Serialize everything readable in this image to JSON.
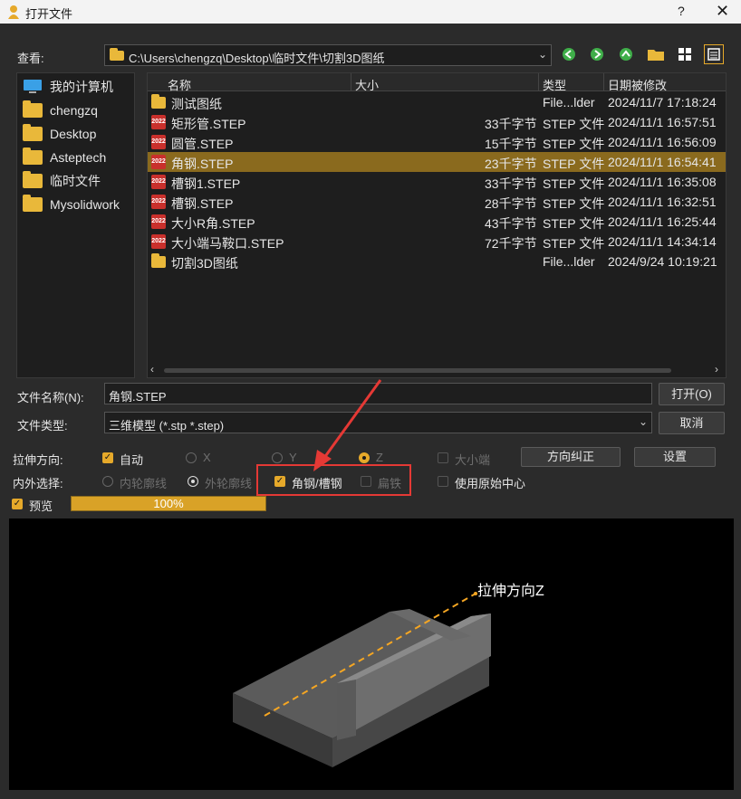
{
  "window": {
    "title": "打开文件",
    "help": "?",
    "close": "✕"
  },
  "lookin": {
    "label": "查看:",
    "path": "C:\\Users\\chengzq\\Desktop\\临时文件\\切割3D图纸"
  },
  "places": [
    {
      "label": "我的计算机",
      "icon": "computer-icon"
    },
    {
      "label": "chengzq",
      "icon": "folder-icon"
    },
    {
      "label": "Desktop",
      "icon": "folder-icon"
    },
    {
      "label": "Asteptech",
      "icon": "folder-icon"
    },
    {
      "label": "临时文件",
      "icon": "folder-icon"
    },
    {
      "label": "Mysolidwork",
      "icon": "folder-icon"
    }
  ],
  "columns": {
    "name": "名称",
    "size": "大小",
    "type": "类型",
    "date": "日期被修改"
  },
  "files": [
    {
      "name": "测试图纸",
      "size": "",
      "type": "File...lder",
      "date": "2024/11/7 17:18:24",
      "kind": "folder"
    },
    {
      "name": "矩形管.STEP",
      "size": "33千字节",
      "type": "STEP 文件",
      "date": "2024/11/1 16:57:51",
      "kind": "step"
    },
    {
      "name": "圆管.STEP",
      "size": "15千字节",
      "type": "STEP 文件",
      "date": "2024/11/1 16:56:09",
      "kind": "step"
    },
    {
      "name": "角钢.STEP",
      "size": "23千字节",
      "type": "STEP 文件",
      "date": "2024/11/1 16:54:41",
      "kind": "step",
      "selected": true
    },
    {
      "name": "槽钢1.STEP",
      "size": "33千字节",
      "type": "STEP 文件",
      "date": "2024/11/1 16:35:08",
      "kind": "step"
    },
    {
      "name": "槽钢.STEP",
      "size": "28千字节",
      "type": "STEP 文件",
      "date": "2024/11/1 16:32:51",
      "kind": "step"
    },
    {
      "name": "大小R角.STEP",
      "size": "43千字节",
      "type": "STEP 文件",
      "date": "2024/11/1 16:25:44",
      "kind": "step"
    },
    {
      "name": "大小端马鞍口.STEP",
      "size": "72千字节",
      "type": "STEP 文件",
      "date": "2024/11/1 14:34:14",
      "kind": "step"
    },
    {
      "name": "切割3D图纸",
      "size": "",
      "type": "File...lder",
      "date": "2024/9/24 10:19:21",
      "kind": "folder"
    }
  ],
  "filename": {
    "label": "文件名称(N):",
    "value": "角钢.STEP"
  },
  "filetype": {
    "label": "文件类型:",
    "value": "三维模型 (*.stp *.step)"
  },
  "buttons": {
    "open": "打开(O)",
    "cancel": "取消",
    "correct": "方向纠正",
    "settings": "设置"
  },
  "stretch": {
    "label": "拉伸方向:",
    "auto": "自动",
    "x": "X",
    "y": "Y",
    "z": "Z",
    "big_small": "大小端"
  },
  "inout": {
    "label": "内外选择:",
    "inner": "内轮廓线",
    "outer": "外轮廓线",
    "angle_channel": "角钢/槽钢",
    "flat": "扁铁",
    "use_origin": "使用原始中心"
  },
  "preview": {
    "label": "预览",
    "progress": "100%",
    "progress_value": 1.0,
    "annotation": "拉伸方向Z"
  },
  "colors": {
    "accent": "#e6a92a",
    "selection": "#8a6a1e",
    "highlight_box": "#e53935",
    "dash": "#f5a623"
  }
}
